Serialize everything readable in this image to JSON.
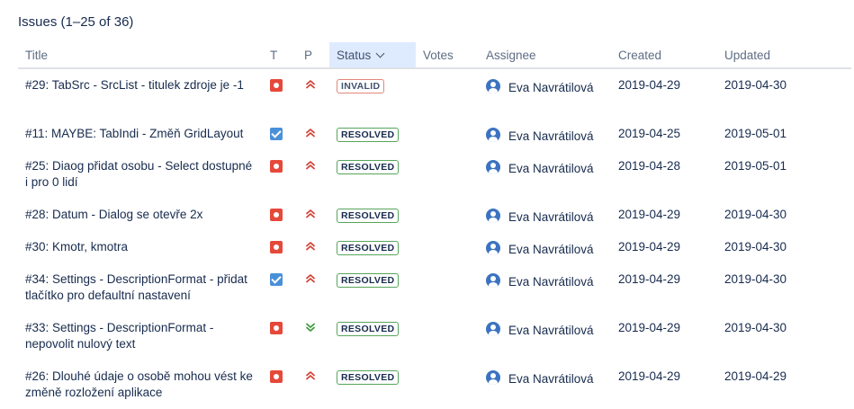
{
  "heading": "Issues (1–25 of 36)",
  "columns": {
    "title": "Title",
    "type": "T",
    "priority": "P",
    "status": "Status",
    "votes": "Votes",
    "assignee": "Assignee",
    "created": "Created",
    "updated": "Updated"
  },
  "sort": {
    "column": "status",
    "direction": "descending"
  },
  "colors": {
    "bug": "#e5493a",
    "task": "#4a90d9",
    "priority_high": "#d04437",
    "priority_low": "#3f9a3f",
    "resolved": "#57a55a",
    "invalid": "#e3877b",
    "sorted_header_bg": "#deebff"
  },
  "rows": [
    {
      "title": "#29: TabSrc - SrcList - titulek zdroje je -1",
      "type": "bug",
      "priority": "high",
      "status": "INVALID",
      "votes": "",
      "assignee": "Eva Navrátilová",
      "created": "2019-04-29",
      "updated": "2019-04-30"
    },
    {
      "title": "#11: MAYBE: TabIndi - Změň GridLayout",
      "type": "task",
      "priority": "high",
      "status": "RESOLVED",
      "votes": "",
      "assignee": "Eva Navrátilová",
      "created": "2019-04-25",
      "updated": "2019-05-01"
    },
    {
      "title": "#25: Diaog přidat osobu - Select dostupné i pro 0 lidí",
      "type": "bug",
      "priority": "high",
      "status": "RESOLVED",
      "votes": "",
      "assignee": "Eva Navrátilová",
      "created": "2019-04-28",
      "updated": "2019-05-01"
    },
    {
      "title": "#28: Datum - Dialog se otevře 2x",
      "type": "bug",
      "priority": "high",
      "status": "RESOLVED",
      "votes": "",
      "assignee": "Eva Navrátilová",
      "created": "2019-04-29",
      "updated": "2019-04-30"
    },
    {
      "title": "#30: Kmotr, kmotra",
      "type": "bug",
      "priority": "high",
      "status": "RESOLVED",
      "votes": "",
      "assignee": "Eva Navrátilová",
      "created": "2019-04-29",
      "updated": "2019-04-30"
    },
    {
      "title": "#34: Settings - DescriptionFormat - přidat tlačítko pro defaultní nastavení",
      "type": "task",
      "priority": "high",
      "status": "RESOLVED",
      "votes": "",
      "assignee": "Eva Navrátilová",
      "created": "2019-04-29",
      "updated": "2019-04-30"
    },
    {
      "title": "#33: Settings - DescriptionFormat - nepovolit nulový text",
      "type": "bug",
      "priority": "low",
      "status": "RESOLVED",
      "votes": "",
      "assignee": "Eva Navrátilová",
      "created": "2019-04-29",
      "updated": "2019-04-30"
    },
    {
      "title": "#26: Dlouhé údaje o osobě mohou vést ke změně rozložení aplikace",
      "type": "bug",
      "priority": "high",
      "status": "RESOLVED",
      "votes": "",
      "assignee": "Eva Navrátilová",
      "created": "2019-04-29",
      "updated": "2019-04-29"
    }
  ]
}
